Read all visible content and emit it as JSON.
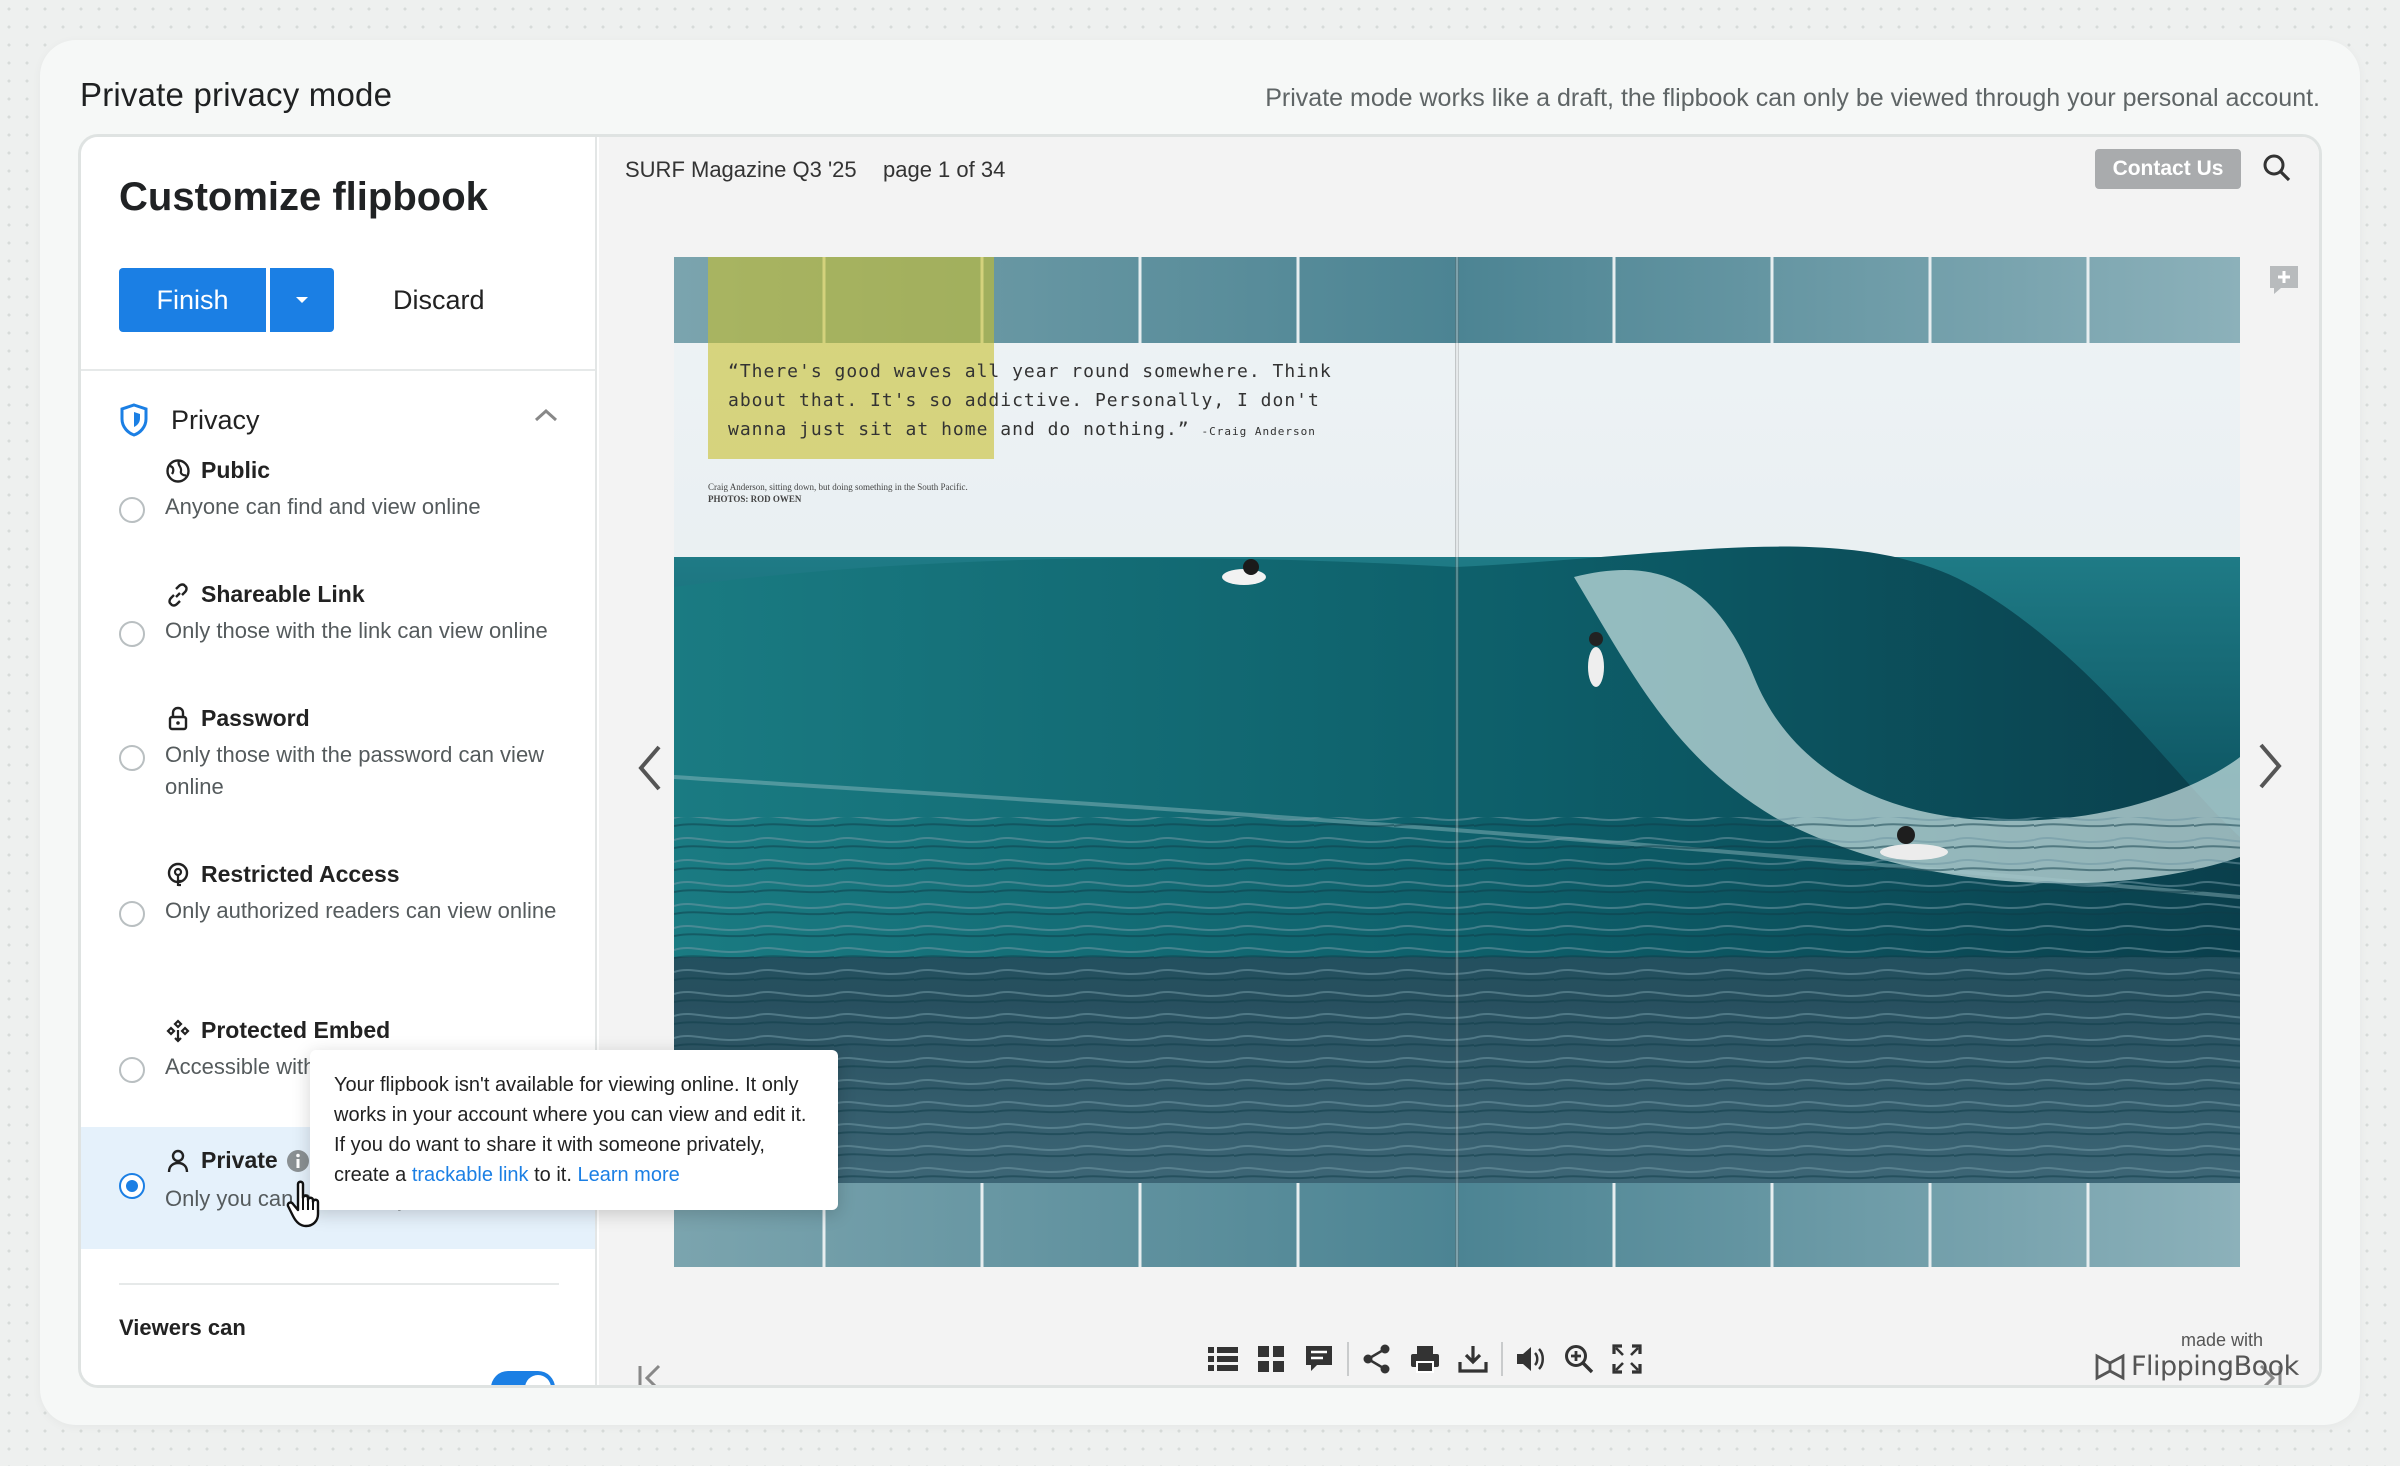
{
  "header": {
    "title": "Private privacy mode",
    "description": "Private mode works like a draft, the flipbook can only be viewed through your personal account."
  },
  "sidebar": {
    "title": "Customize flipbook",
    "finish_label": "Finish",
    "discard_label": "Discard",
    "section_label": "Privacy",
    "options": [
      {
        "name": "Public",
        "desc": "Anyone can find and view online",
        "icon": "globe-icon",
        "selected": false
      },
      {
        "name": "Shareable Link",
        "desc": "Only those with the link can view online",
        "icon": "link-icon",
        "selected": false
      },
      {
        "name": "Password",
        "desc": "Only those with the password can view online",
        "icon": "lock-icon",
        "selected": false
      },
      {
        "name": "Restricted Access",
        "desc": "Only authorized readers can view online",
        "icon": "restricted-icon",
        "selected": false
      },
      {
        "name": "Protected Embed",
        "desc": "Accessible with",
        "icon": "embed-icon",
        "selected": false
      },
      {
        "name": "Private",
        "desc": "Only you can access in your account",
        "icon": "person-icon",
        "selected": true
      }
    ],
    "viewers_title": "Viewers can"
  },
  "viewer": {
    "doc_title": "SURF Magazine Q3 '25",
    "page_info": "page 1 of 34",
    "contact_label": "Contact Us",
    "quote": "“There's good waves all year round somewhere. Think about that. It's so addictive. Personally, I don't wanna just sit at home and do nothing.”",
    "quote_author": "-Craig Anderson",
    "caption": "Craig Anderson, sitting down, but doing something in the South Pacific.",
    "caption_credit": "PHOTOS: ROD OWEN",
    "made_with": "made with",
    "brand": "FlippingBook"
  },
  "tooltip": {
    "text_1": "Your flipbook isn't available for viewing online. It only works in your account where you can view and edit it. If you do want to share it with someone privately, create a ",
    "link_1": "trackable link",
    "text_2": " to it. ",
    "link_2": "Learn more"
  },
  "colors": {
    "accent": "#1b7fe4",
    "contact_button": "#a9abad",
    "selected_row": "#e5f1fb"
  }
}
